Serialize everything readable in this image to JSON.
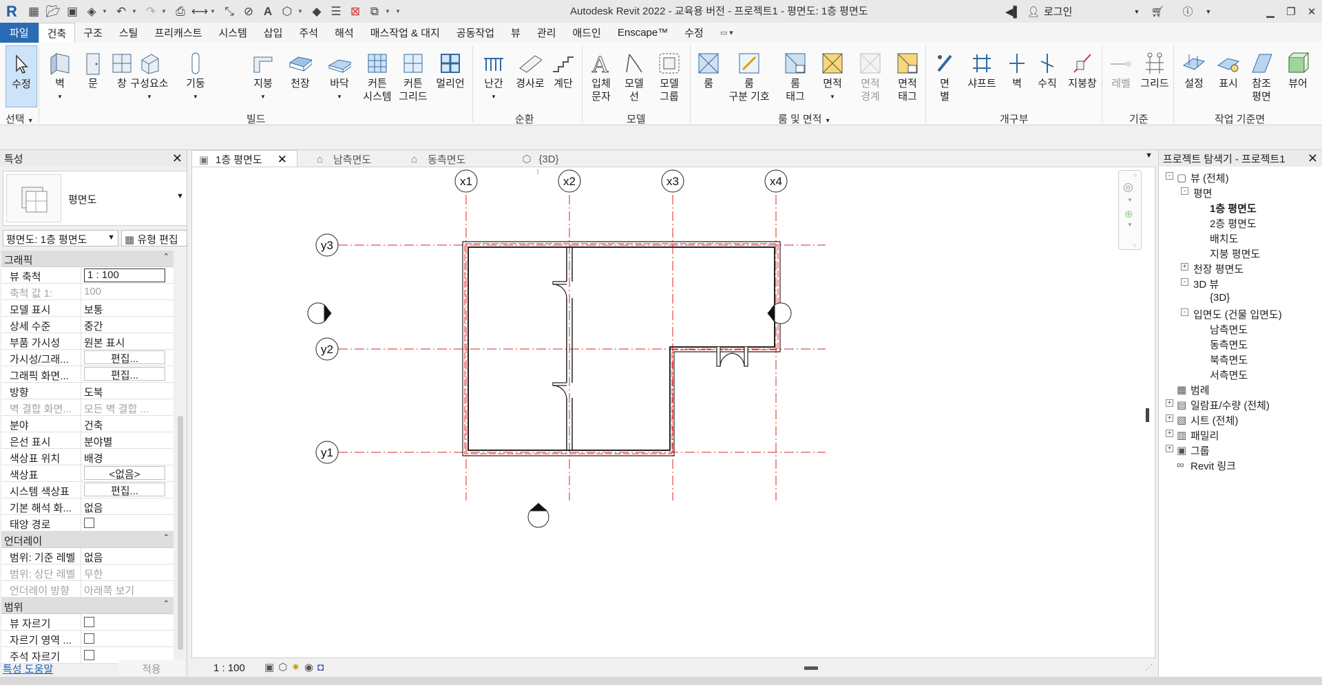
{
  "titlebar": {
    "title": "Autodesk Revit 2022 - 교육용 버전 - 프로젝트1 - 평면도: 1층 평면도",
    "login": "로그인"
  },
  "ribbon_tabs": [
    "파일",
    "건축",
    "구조",
    "스틸",
    "프리캐스트",
    "시스템",
    "삽입",
    "주석",
    "해석",
    "매스작업 & 대지",
    "공동작업",
    "뷰",
    "관리",
    "애드인",
    "Enscape™",
    "수정"
  ],
  "ribbon": {
    "buttons": [
      "수정",
      "벽",
      "문",
      "창",
      "구성요소",
      "기둥",
      "지붕",
      "천장",
      "바닥",
      "커튼\n시스템",
      "커튼\n그리드",
      "멀리언",
      "난간",
      "경사로",
      "계단",
      "입체\n문자",
      "모델\n선",
      "모델\n그룹",
      "룸",
      "룸\n구분 기호",
      "룸\n태그",
      "면적",
      "면적\n경계",
      "면적\n태그",
      "면\n별",
      "샤프트",
      "벽",
      "수직",
      "지붕창",
      "레벨",
      "그리드",
      "설정",
      "표시",
      "참조\n평면",
      "뷰어"
    ],
    "groups": [
      "선택",
      "빌드",
      "순환",
      "모델",
      "룸 및 면적",
      "개구부",
      "기준",
      "작업 기준면"
    ]
  },
  "properties": {
    "title": "특성",
    "type_name": "평면도",
    "instance_selector": "평면도: 1층 평면도",
    "edit_type": "유형 편집",
    "sections": [
      {
        "name": "그래픽",
        "rows": [
          {
            "k": "뷰 축척",
            "v": "1 : 100",
            "kind": "box"
          },
          {
            "k": "축척 값    1:",
            "v": "100",
            "kind": "dis"
          },
          {
            "k": "모델 표시",
            "v": "보통",
            "kind": "text"
          },
          {
            "k": "상세 수준",
            "v": "중간",
            "kind": "text"
          },
          {
            "k": "부품 가시성",
            "v": "원본 표시",
            "kind": "text"
          },
          {
            "k": "가시성/그래...",
            "v": "편집...",
            "kind": "btn"
          },
          {
            "k": "그래픽 화면...",
            "v": "편집...",
            "kind": "btn"
          },
          {
            "k": "방향",
            "v": "도북",
            "kind": "text"
          },
          {
            "k": "벽 결합 화면...",
            "v": "모든 벽 결합 ...",
            "kind": "dis"
          },
          {
            "k": "분야",
            "v": "건축",
            "kind": "text"
          },
          {
            "k": "은선 표시",
            "v": "분야별",
            "kind": "text"
          },
          {
            "k": "색상표 위치",
            "v": "배경",
            "kind": "text"
          },
          {
            "k": "색상표",
            "v": "<없음>",
            "kind": "btn"
          },
          {
            "k": "시스템 색상표",
            "v": "편집...",
            "kind": "btn"
          },
          {
            "k": "기본 해석 화...",
            "v": "없음",
            "kind": "text"
          },
          {
            "k": "태양 경로",
            "v": "",
            "kind": "check"
          }
        ]
      },
      {
        "name": "언더레이",
        "rows": [
          {
            "k": "범위: 기준 레벨",
            "v": "없음",
            "kind": "text"
          },
          {
            "k": "범위: 상단 레벨",
            "v": "무한",
            "kind": "dis"
          },
          {
            "k": "언더레이 방향",
            "v": "아래쪽 보기",
            "kind": "dis"
          }
        ]
      },
      {
        "name": "범위",
        "rows": [
          {
            "k": "뷰 자르기",
            "v": "",
            "kind": "check"
          },
          {
            "k": "자르기 영역 ...",
            "v": "",
            "kind": "check"
          },
          {
            "k": "주석 자르기",
            "v": "",
            "kind": "check"
          }
        ]
      }
    ],
    "help_link": "특성 도움말",
    "apply": "적용"
  },
  "view_tabs": [
    {
      "label": "1층 평면도",
      "active": true,
      "icon": "floor-plan-icon"
    },
    {
      "label": "남측면도",
      "active": false,
      "icon": "elevation-icon"
    },
    {
      "label": "동측면도",
      "active": false,
      "icon": "elevation-icon"
    },
    {
      "label": "{3D}",
      "active": false,
      "icon": "3d-view-icon"
    }
  ],
  "view": {
    "scale": "1 : 100",
    "grids_x": [
      "x1",
      "x2",
      "x3",
      "x4"
    ],
    "grids_y": [
      "y3",
      "y2",
      "y1"
    ]
  },
  "browser": {
    "title": "프로젝트 탐색기 - 프로젝트1",
    "items": [
      {
        "label": "뷰 (전체)",
        "level": 0,
        "tog": "-",
        "icon": "views-icon"
      },
      {
        "label": "평면",
        "level": 1,
        "tog": "-"
      },
      {
        "label": "1층 평면도",
        "level": 2,
        "bold": true
      },
      {
        "label": "2층 평면도",
        "level": 2
      },
      {
        "label": "배치도",
        "level": 2
      },
      {
        "label": "지붕 평면도",
        "level": 2
      },
      {
        "label": "천장 평면도",
        "level": 1,
        "tog": "+"
      },
      {
        "label": "3D 뷰",
        "level": 1,
        "tog": "-"
      },
      {
        "label": "{3D}",
        "level": 2
      },
      {
        "label": "입면도 (건물 입면도)",
        "level": 1,
        "tog": "-"
      },
      {
        "label": "남측면도",
        "level": 2
      },
      {
        "label": "동측면도",
        "level": 2
      },
      {
        "label": "북측면도",
        "level": 2
      },
      {
        "label": "서측면도",
        "level": 2
      },
      {
        "label": "범례",
        "level": 0,
        "icon": "legend-icon"
      },
      {
        "label": "일람표/수량 (전체)",
        "level": 0,
        "tog": "+",
        "icon": "schedule-icon"
      },
      {
        "label": "시트 (전체)",
        "level": 0,
        "tog": "+",
        "icon": "sheet-icon"
      },
      {
        "label": "패밀리",
        "level": 0,
        "tog": "+",
        "icon": "family-icon"
      },
      {
        "label": "그룹",
        "level": 0,
        "tog": "+",
        "icon": "group-icon"
      },
      {
        "label": "Revit 링크",
        "level": 0,
        "icon": "link-icon"
      }
    ]
  },
  "colors": {
    "accent": "#2a6bb5",
    "grid_line": "#e02020",
    "selected": "#cde3f7"
  }
}
